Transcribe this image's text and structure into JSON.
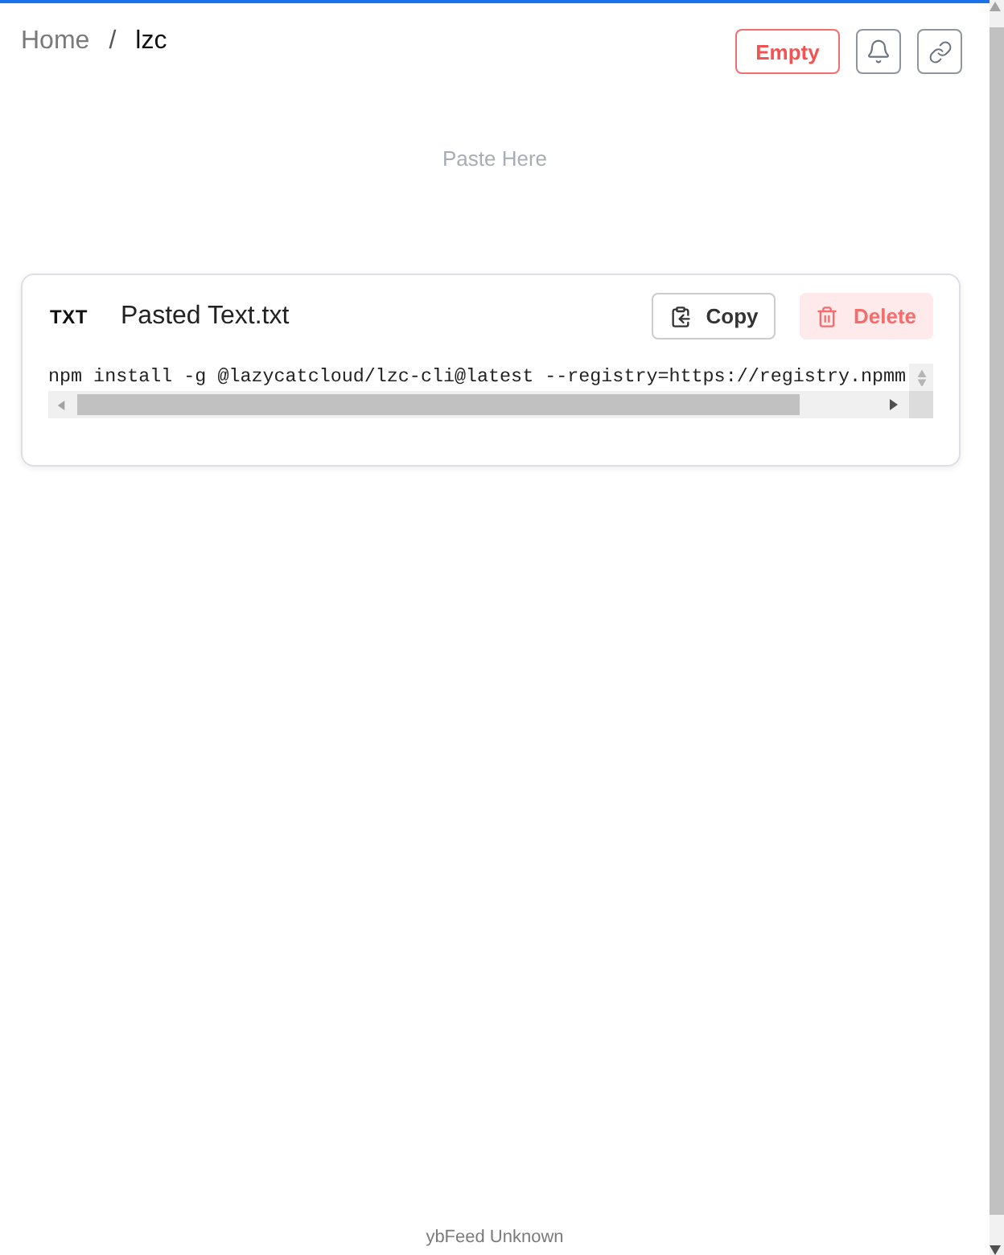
{
  "breadcrumb": {
    "separator": "/",
    "items": [
      {
        "label": "Home",
        "current": false
      },
      {
        "label": "lzc",
        "current": true
      }
    ]
  },
  "toolbar": {
    "empty_button": "Empty"
  },
  "paste_area": {
    "hint": "Paste Here"
  },
  "items": [
    {
      "kind": "text",
      "type_label": "TXT",
      "name": "Pasted Text.txt",
      "copy_button": "Copy",
      "delete_button": "Delete",
      "content": "npm install -g @lazycatcloud/lzc-cli@latest --registry=https://registry.npmm"
    }
  ],
  "footer": "ybFeed Unknown"
}
